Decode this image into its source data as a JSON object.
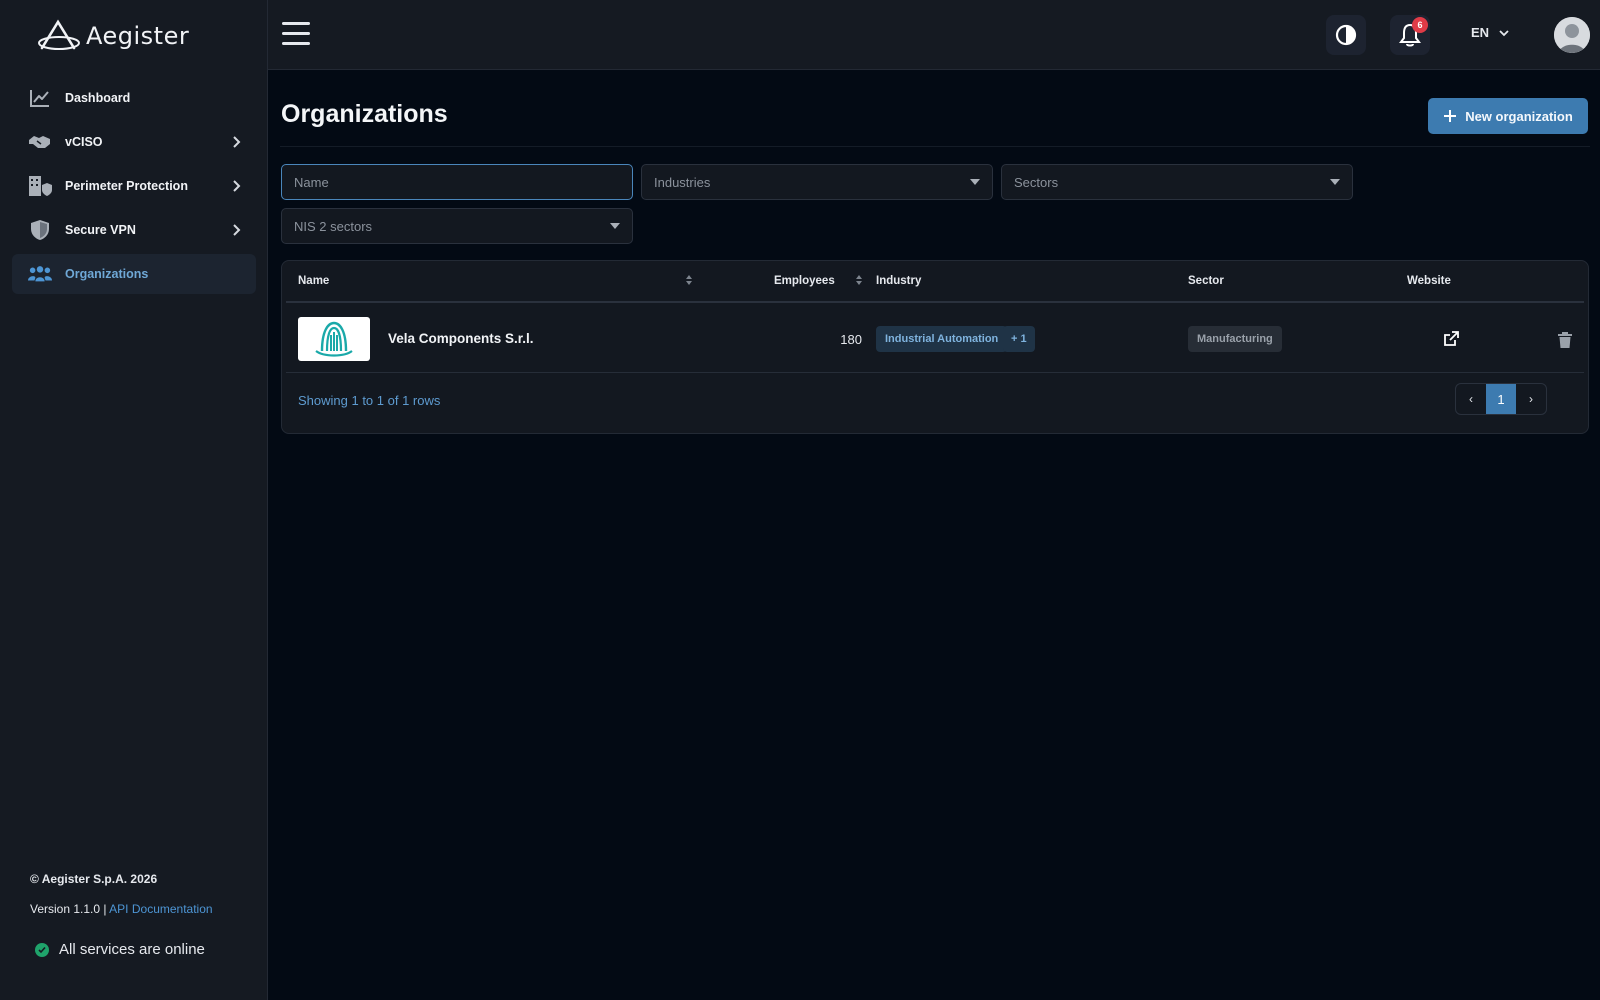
{
  "brand": {
    "name": "Aegister"
  },
  "sidebar": {
    "items": [
      {
        "label": "Dashboard",
        "icon": "chart-line-icon",
        "has_children": false,
        "active": false
      },
      {
        "label": "vCISO",
        "icon": "handshake-icon",
        "has_children": true,
        "active": false
      },
      {
        "label": "Perimeter Protection",
        "icon": "building-shield-icon",
        "has_children": true,
        "active": false
      },
      {
        "label": "Secure VPN",
        "icon": "shield-icon",
        "has_children": true,
        "active": false
      },
      {
        "label": "Organizations",
        "icon": "people-group-icon",
        "has_children": false,
        "active": true
      }
    ],
    "footer": {
      "copyright": "© Aegister S.p.A. 2026",
      "version": "Version 1.1.0 |",
      "api_link": "API Documentation",
      "status": "All services are online",
      "status_color": "#1fa36b"
    }
  },
  "topbar": {
    "notifications_count": "6",
    "language": "EN"
  },
  "page": {
    "title": "Organizations",
    "new_button": "New organization",
    "accent": "#3d7bb0"
  },
  "filters": {
    "name_placeholder": "Name",
    "industries_placeholder": "Industries",
    "sectors_placeholder": "Sectors",
    "nis2_placeholder": "NIS 2 sectors"
  },
  "table": {
    "columns": {
      "name": "Name",
      "employees": "Employees",
      "industry": "Industry",
      "sector": "Sector",
      "website": "Website"
    },
    "rows": [
      {
        "name": "Vela Components S.r.l.",
        "employees": "180",
        "industry_tag": "Industrial Automation",
        "industry_more": "+ 1",
        "sector": "Manufacturing"
      }
    ],
    "showing": "Showing 1 to 1 of 1 rows",
    "pagination": {
      "prev": "‹",
      "current": "1",
      "next": "›"
    }
  }
}
